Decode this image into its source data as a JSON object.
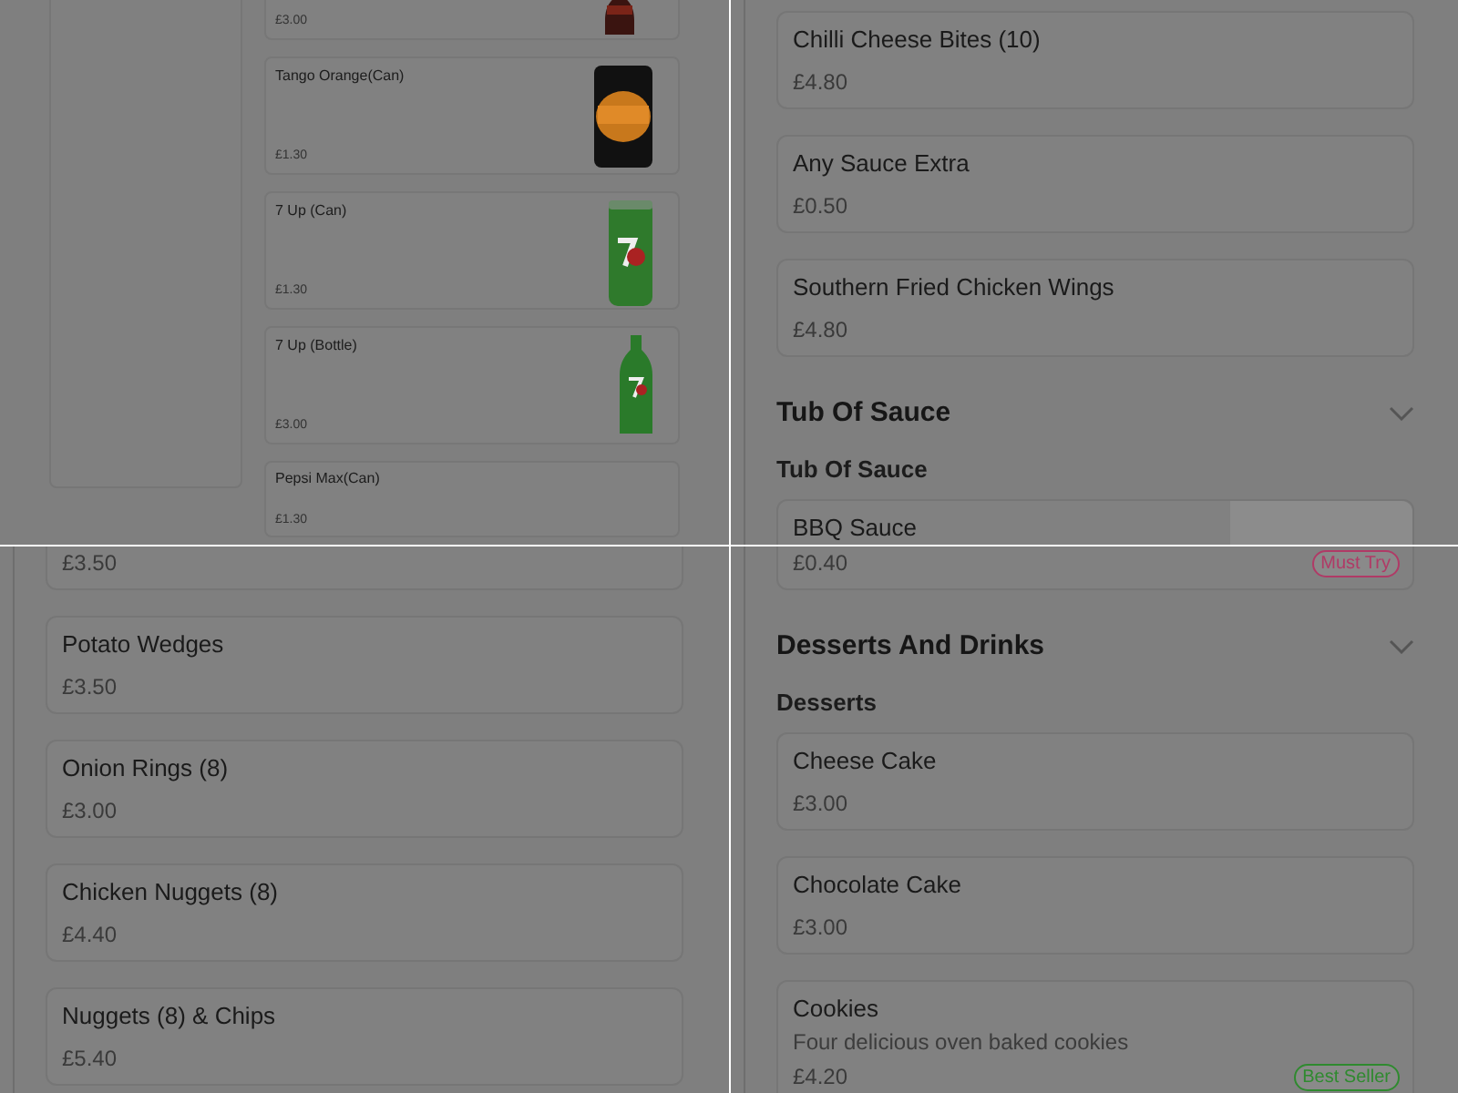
{
  "panels": [
    {
      "kind": "drinks",
      "items": [
        {
          "kind": "cola_bottle",
          "price": "£3.00"
        },
        {
          "kind": "orange_can",
          "name": "Tango Orange(Can)",
          "price": "£1.30"
        },
        {
          "kind": "green_can",
          "name": "7 Up (Can)",
          "price": "£1.30"
        },
        {
          "kind": "green_bottle",
          "name": "7 Up (Bottle)",
          "price": "£3.00"
        },
        {
          "kind": "plain",
          "name": "Pepsi Max(Can)",
          "price": "£1.30"
        }
      ]
    },
    {
      "kind": "menu",
      "blocks": [
        {
          "kind": "card",
          "name": "Chilli Cheese Bites (10)",
          "price": "£4.80"
        },
        {
          "kind": "card",
          "name": "Any Sauce Extra",
          "price": "£0.50"
        },
        {
          "kind": "card",
          "name": "Southern Fried Chicken Wings",
          "price": "£4.80"
        },
        {
          "kind": "heading",
          "text": "Tub Of Sauce"
        },
        {
          "kind": "subheading",
          "text": "Tub Of Sauce"
        },
        {
          "kind": "card",
          "name": "BBQ Sauce",
          "photo": true
        }
      ]
    },
    {
      "kind": "menu",
      "blocks": [
        {
          "kind": "card",
          "price": "£3.50"
        },
        {
          "kind": "card",
          "name": "Potato Wedges",
          "price": "£3.50"
        },
        {
          "kind": "card",
          "name": "Onion Rings (8)",
          "price": "£3.00"
        },
        {
          "kind": "card",
          "name": "Chicken Nuggets (8)",
          "price": "£4.40"
        },
        {
          "kind": "card",
          "name": "Nuggets (8) & Chips",
          "price": "£5.40"
        }
      ]
    },
    {
      "kind": "menu",
      "blocks": [
        {
          "kind": "card",
          "price": "£0.40",
          "badge": {
            "label": "Must Try",
            "color": "#b03a66"
          }
        },
        {
          "kind": "heading",
          "text": "Desserts And Drinks"
        },
        {
          "kind": "subheading",
          "text": "Desserts"
        },
        {
          "kind": "card",
          "name": "Cheese Cake",
          "price": "£3.00"
        },
        {
          "kind": "card",
          "name": "Chocolate Cake",
          "price": "£3.00"
        },
        {
          "kind": "card",
          "name": "Cookies",
          "description": "Four delicious oven baked cookies",
          "price": "£4.20",
          "badge": {
            "label": "Best Seller",
            "color": "#2f8a2f"
          }
        }
      ]
    }
  ]
}
